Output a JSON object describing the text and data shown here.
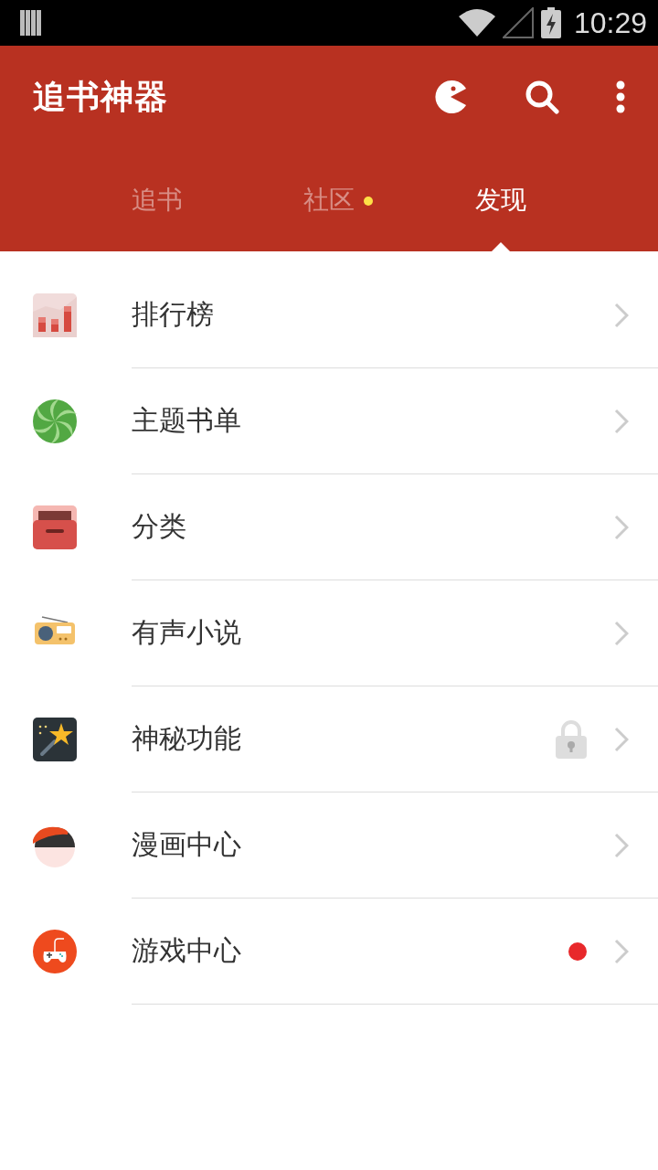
{
  "status_bar": {
    "time": "10:29"
  },
  "app_bar": {
    "title": "追书神器"
  },
  "tabs": [
    {
      "label": "追书",
      "selected": false,
      "dot": false
    },
    {
      "label": "社区",
      "selected": false,
      "dot": true
    },
    {
      "label": "发现",
      "selected": true,
      "dot": false
    }
  ],
  "items": [
    {
      "kind": "ranking",
      "label": "排行榜",
      "locked": false,
      "dot": false
    },
    {
      "kind": "booklist",
      "label": "主题书单",
      "locked": false,
      "dot": false
    },
    {
      "kind": "category",
      "label": "分类",
      "locked": false,
      "dot": false
    },
    {
      "kind": "audio",
      "label": "有声小说",
      "locked": false,
      "dot": false
    },
    {
      "kind": "magic",
      "label": "神秘功能",
      "locked": true,
      "dot": false
    },
    {
      "kind": "comic",
      "label": "漫画中心",
      "locked": false,
      "dot": false
    },
    {
      "kind": "game",
      "label": "游戏中心",
      "locked": false,
      "dot": true
    }
  ]
}
